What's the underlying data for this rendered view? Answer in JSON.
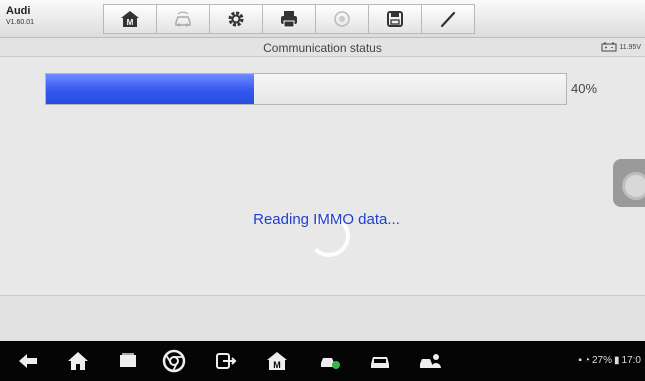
{
  "app": {
    "name": "Audi",
    "version": "V1.60.01"
  },
  "toolbar": {
    "buttons": [
      {
        "icon": "home-m-icon"
      },
      {
        "icon": "vehicle-swap-icon"
      },
      {
        "icon": "gear-icon"
      },
      {
        "icon": "print-icon"
      },
      {
        "icon": "help-icon"
      },
      {
        "icon": "save-icon"
      },
      {
        "icon": "pen-icon"
      }
    ]
  },
  "status": {
    "title": "Communication status",
    "battery_voltage": "11.95V"
  },
  "progress": {
    "value": 0.4,
    "label": "40%"
  },
  "message": "Reading IMMO data...",
  "android_nav": {
    "status_text": "27%",
    "time": "17:0"
  },
  "colors": {
    "accent": "#2f55ea",
    "message": "#1e3fd0"
  }
}
